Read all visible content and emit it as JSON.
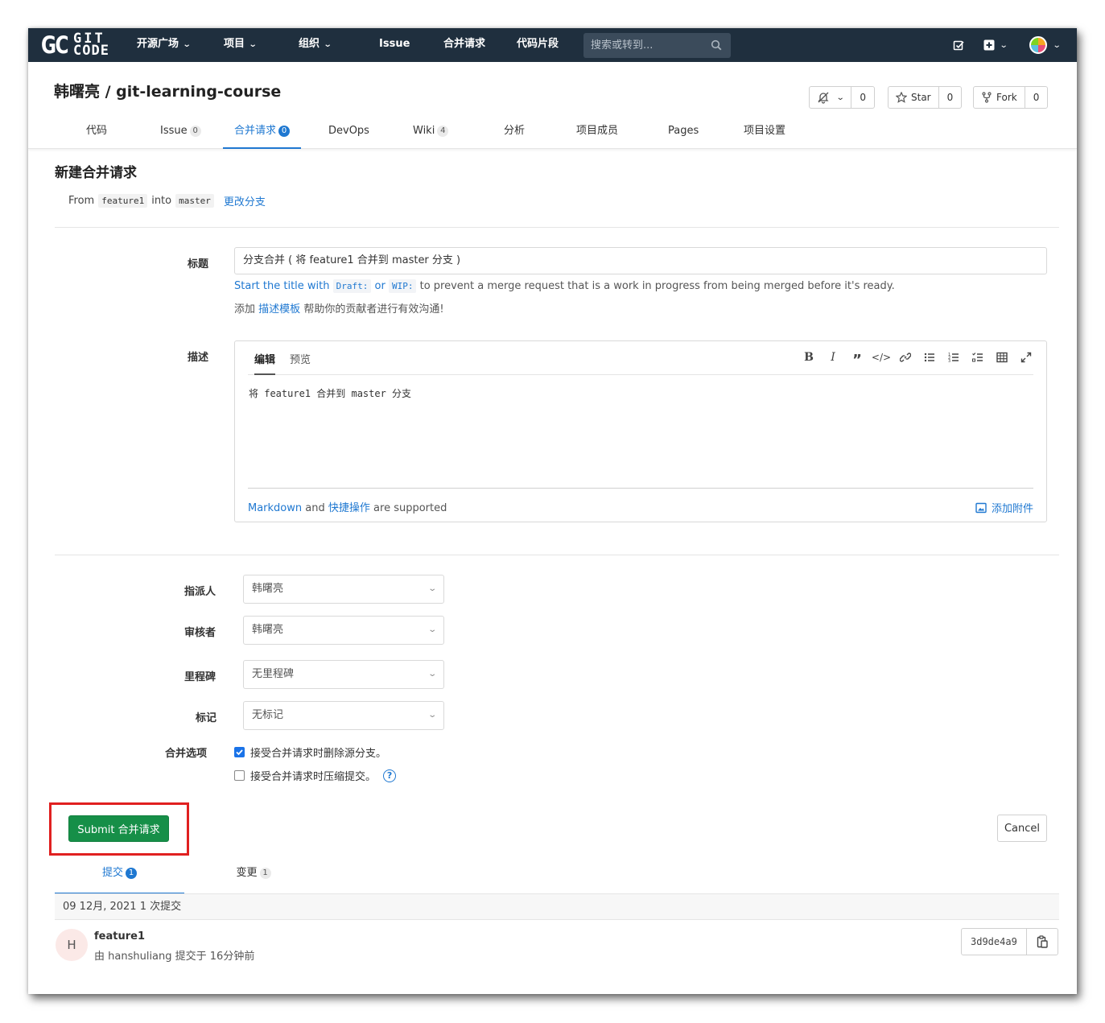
{
  "navbar": {
    "logo_left": "GC",
    "logo_top": "GIT",
    "logo_bottom": "CODE",
    "items": [
      {
        "label": "开源广场",
        "dropdown": true
      },
      {
        "label": "项目",
        "dropdown": true
      },
      {
        "label": "组织",
        "dropdown": true
      },
      {
        "label": "Issue",
        "dropdown": false
      },
      {
        "label": "合并请求",
        "dropdown": false
      },
      {
        "label": "代码片段",
        "dropdown": false
      }
    ],
    "search_placeholder": "搜索或转到..."
  },
  "project": {
    "title": "韩曙亮 / git-learning-course",
    "notify_count": "0",
    "star_label": "Star",
    "star_count": "0",
    "fork_label": "Fork",
    "fork_count": "0"
  },
  "tabs": [
    {
      "label": "代码",
      "badge": ""
    },
    {
      "label": "Issue",
      "badge": "0"
    },
    {
      "label": "合并请求",
      "badge": "0"
    },
    {
      "label": "DevOps",
      "badge": ""
    },
    {
      "label": "Wiki",
      "badge": "4"
    },
    {
      "label": "分析",
      "badge": ""
    },
    {
      "label": "项目成员",
      "badge": ""
    },
    {
      "label": "Pages",
      "badge": ""
    },
    {
      "label": "项目设置",
      "badge": ""
    }
  ],
  "page": {
    "heading": "新建合并请求",
    "from_label": "From",
    "source_branch": "feature1",
    "into_label": "into",
    "target_branch": "master",
    "change_branches": "更改分支"
  },
  "form": {
    "title_label": "标题",
    "title_value": "分支合并 ( 将 feature1 合并到 master 分支 )",
    "wip_hint_pre": "Start the title with",
    "wip_draft": "Draft:",
    "wip_or": "or",
    "wip_wip": "WIP:",
    "wip_hint_post": "to prevent a merge request that is a work in progress from being merged before it's ready.",
    "template_pre": "添加",
    "template_link": "描述模板",
    "template_post": "帮助你的贡献者进行有效沟通!",
    "desc_label": "描述",
    "editor_tab_edit": "编辑",
    "editor_tab_preview": "预览",
    "desc_value": "将 feature1 合并到 master 分支",
    "markdown_link": "Markdown",
    "and_label": "and",
    "quick_actions_link": "快捷操作",
    "supported_label": "are supported",
    "attach_label": "添加附件",
    "assignee_label": "指派人",
    "assignee_value": "韩曙亮",
    "reviewer_label": "审核者",
    "reviewer_value": "韩曙亮",
    "milestone_label": "里程碑",
    "milestone_value": "无里程碑",
    "labels_label": "标记",
    "labels_value": "无标记",
    "merge_options_label": "合并选项",
    "option_delete_branch": "接受合并请求时删除源分支。",
    "option_delete_branch_checked": true,
    "option_squash": "接受合并请求时压缩提交。",
    "option_squash_checked": false,
    "submit_label": "Submit 合并请求",
    "cancel_label": "Cancel"
  },
  "bottom_tabs": [
    {
      "label": "提交",
      "badge": "1"
    },
    {
      "label": "变更",
      "badge": "1"
    }
  ],
  "commits": {
    "day_header": "09 12月, 2021 1 次提交",
    "items": [
      {
        "avatar_letter": "H",
        "title": "feature1",
        "meta": "由 hanshuliang 提交于 16分钟前",
        "sha": "3d9de4a9"
      }
    ]
  },
  "colors": {
    "navbar_bg": "#1f2f3e",
    "accent": "#1f78d1",
    "submit_bg": "#168f48",
    "highlight": "#e02020"
  }
}
